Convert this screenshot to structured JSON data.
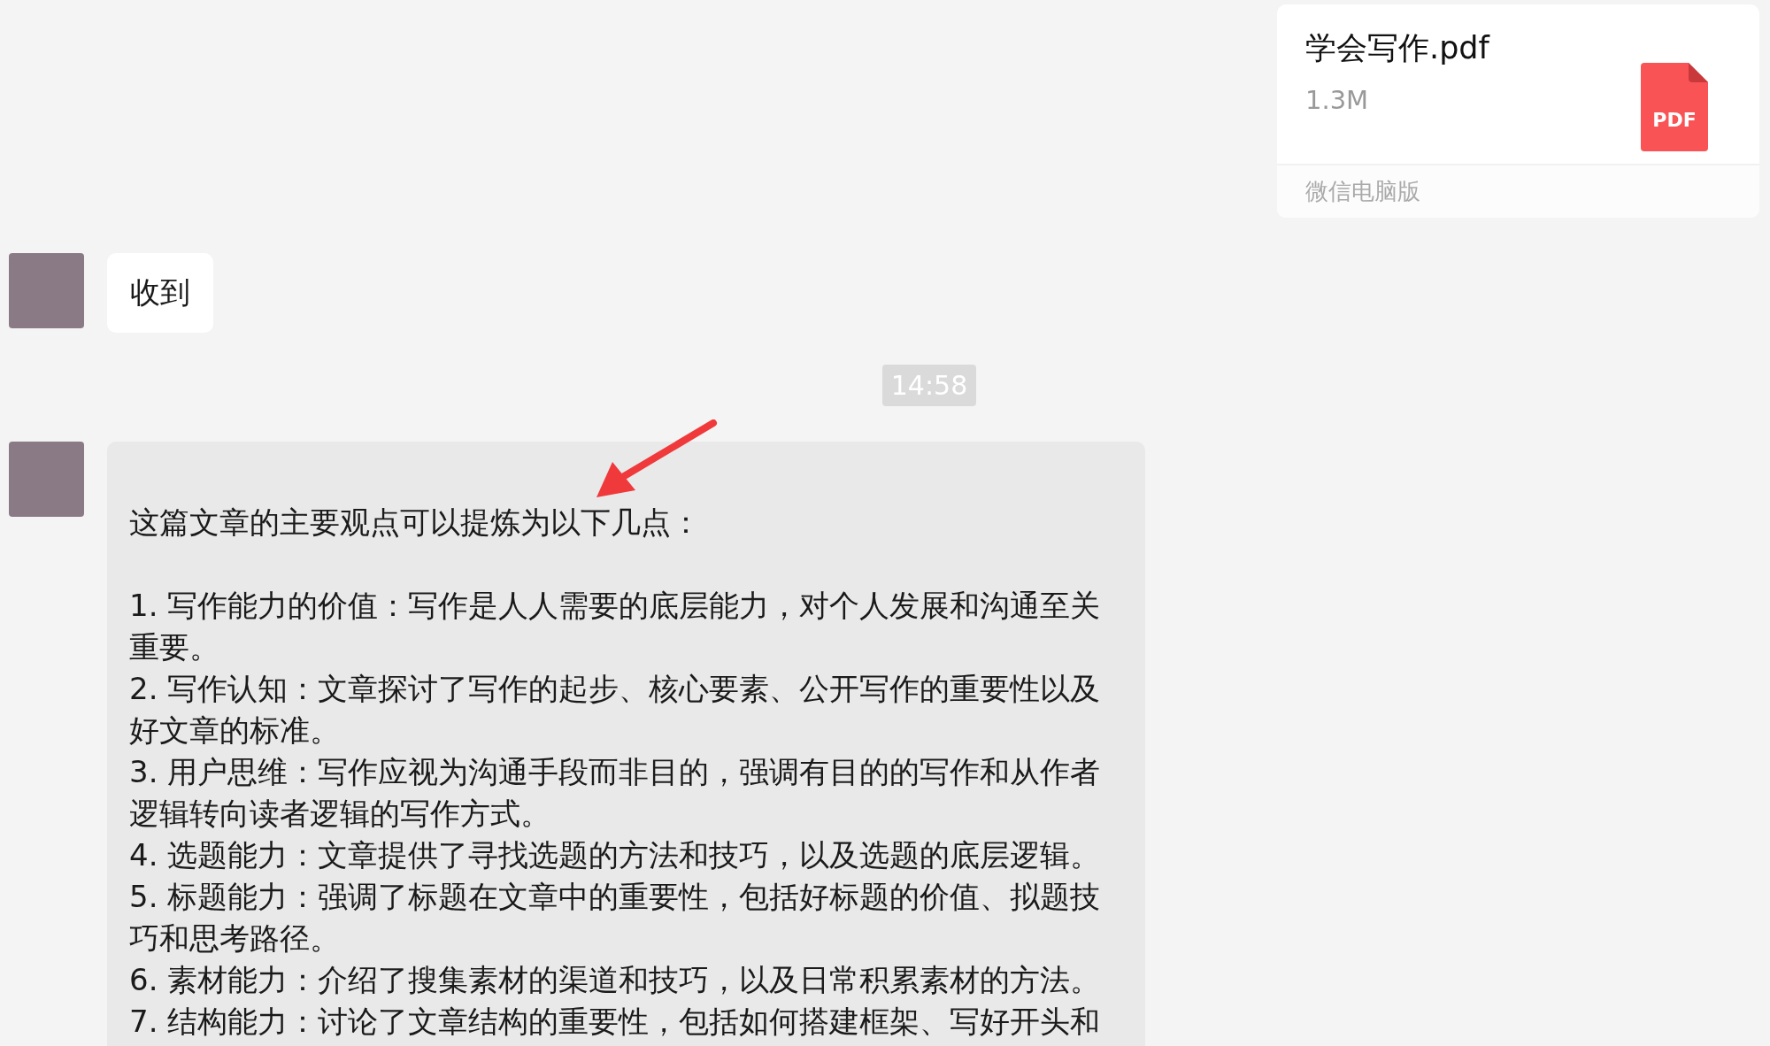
{
  "file_message": {
    "name": "学会写作.pdf",
    "size": "1.3M",
    "icon_label": "PDF",
    "source": "微信电脑版"
  },
  "messages": [
    {
      "kind": "text",
      "selected": false,
      "text": "收到"
    },
    {
      "kind": "time",
      "text": "14:58"
    },
    {
      "kind": "summary",
      "selected": true,
      "intro": "这篇文章的主要观点可以提炼为以下几点：",
      "points": [
        "1. 写作能力的价值：写作是人人需要的底层能力，对个人发展和沟通至关重要。",
        "2. 写作认知：文章探讨了写作的起步、核心要素、公开写作的重要性以及好文章的标准。",
        "3. 用户思维：写作应视为沟通手段而非目的，强调有目的的写作和从作者逻辑转向读者逻辑的写作方式。",
        "4. 选题能力：文章提供了寻找选题的方法和技巧，以及选题的底层逻辑。",
        "5. 标题能力：强调了标题在文章中的重要性，包括好标题的价值、拟题技巧和思考路径。",
        "6. 素材能力：介绍了搜集素材的渠道和技巧，以及日常积累素材的方法。",
        "7. 结构能力：讨论了文章结构的重要性，包括如何搭建框架、写好开头和"
      ]
    }
  ]
}
